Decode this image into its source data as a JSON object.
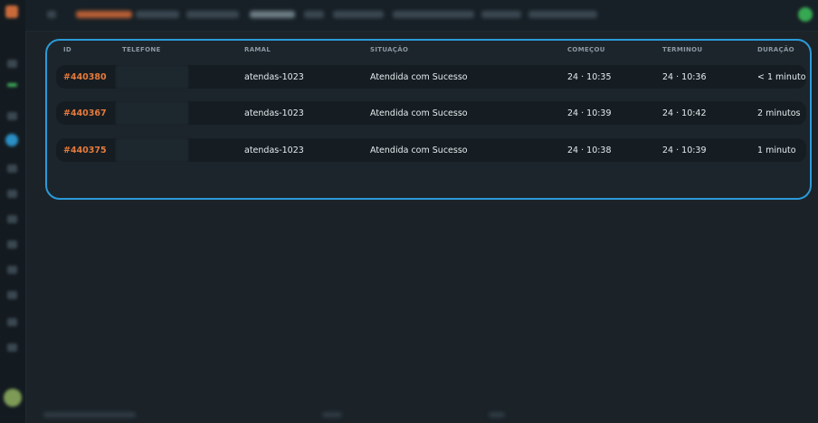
{
  "table": {
    "headers": {
      "id": "ID",
      "telefone": "TELEFONE",
      "ramal": "RAMAL",
      "situacao": "SITUAÇÃO",
      "comecou": "COMEÇOU",
      "terminou": "TERMINOU",
      "duracao": "DURAÇÃO"
    },
    "rows": [
      {
        "id": "#440380",
        "ramal": "atendas-1023",
        "situacao": "Atendida com Sucesso",
        "comecou": "24 · 10:35",
        "terminou": "24 · 10:36",
        "duracao": "< 1 minuto"
      },
      {
        "id": "#440367",
        "ramal": "atendas-1023",
        "situacao": "Atendida com Sucesso",
        "comecou": "24 · 10:39",
        "terminou": "24 · 10:42",
        "duracao": "2 minutos"
      },
      {
        "id": "#440375",
        "ramal": "atendas-1023",
        "situacao": "Atendida com Sucesso",
        "comecou": "24 · 10:38",
        "terminou": "24 · 10:39",
        "duracao": "1 minuto"
      }
    ]
  },
  "colors": {
    "accent": "#2b9ad8",
    "id_orange": "#e67a3d",
    "background": "#1b2329"
  }
}
